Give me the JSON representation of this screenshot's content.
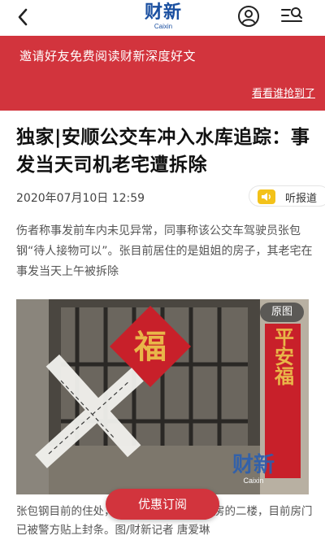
{
  "header": {
    "logo_cn": "财新",
    "logo_en": "Caixin",
    "back_icon": "chevron-left-icon",
    "user_icon": "user-icon",
    "menu_icon": "menu-search-icon"
  },
  "banner": {
    "text": "邀请好友免费阅读财新深度好文",
    "link": "看看谁抢到了",
    "color": "#d2343d"
  },
  "article": {
    "title": "独家|安顺公交车冲入水库追踪：事发当天司机老宅遭拆除",
    "date": "2020年07月10日 12:59",
    "listen_label": "听报道",
    "summary": "伤者称事发前车内未见异常，同事称该公交车驾驶员张包钢“待人接物可以”。张目前居住的是姐姐的房子，其老宅在事发当天上午被拆除",
    "photo": {
      "original_button": "原图",
      "couplet_text": "平安福",
      "fu_char": "福",
      "watermark_cn": "财新",
      "watermark_en": "Caixin"
    },
    "caption": "张包钢目前的住处，是其姐姐位于一栋楼房的二楼，目前房门已被警方贴上封条。图/财新记者 唐爱琳"
  },
  "subscribe_button": "优惠订阅"
}
